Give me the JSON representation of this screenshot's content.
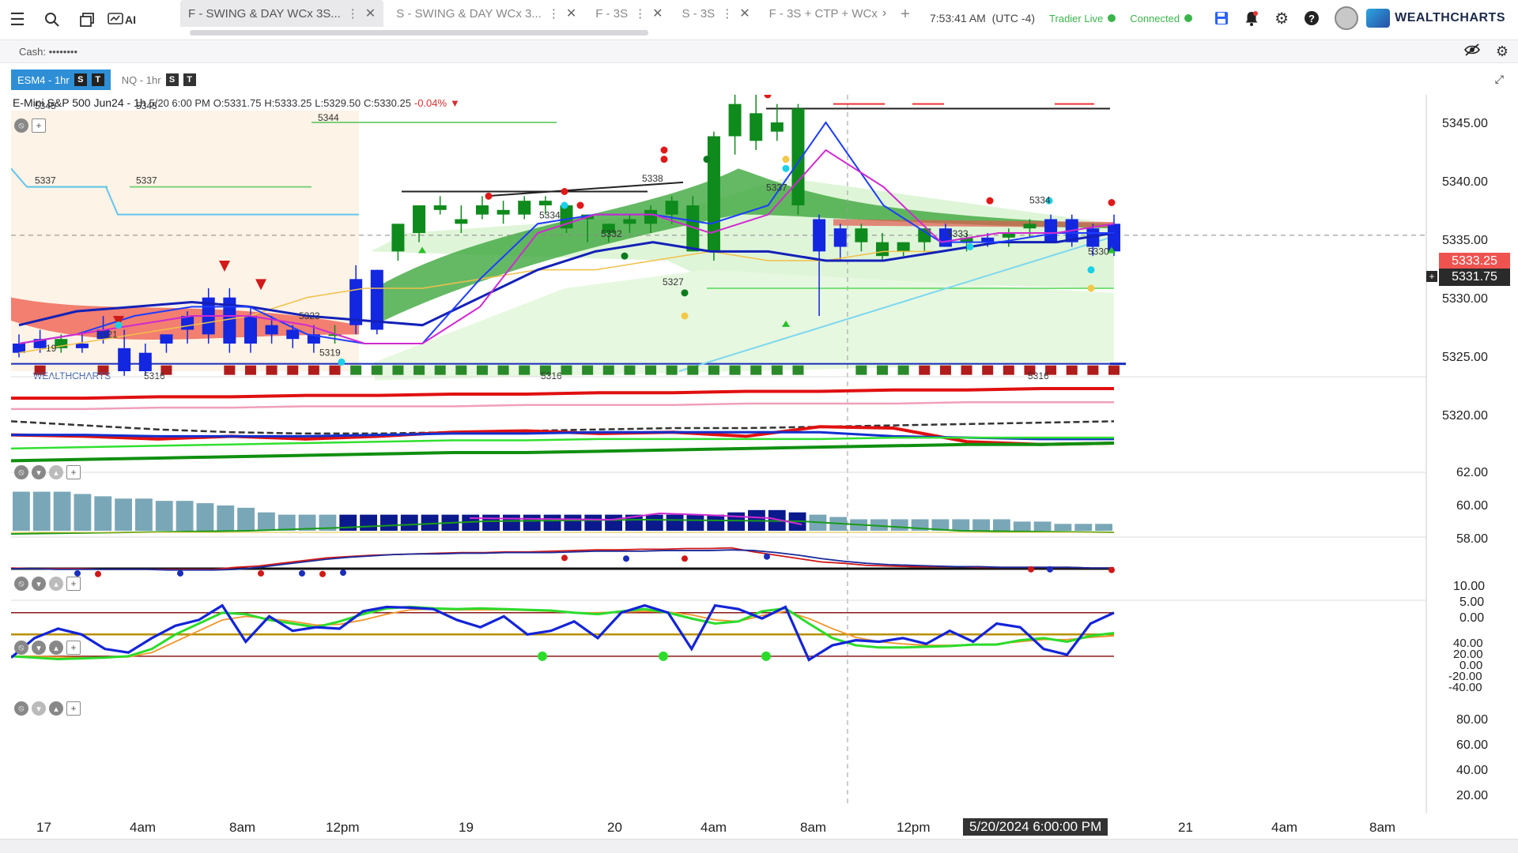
{
  "toolbar": {
    "ai_label": "AI"
  },
  "tabs": [
    {
      "label": "F - SWING & DAY WCx 3S...",
      "active": true
    },
    {
      "label": "S - SWING & DAY WCx 3..."
    },
    {
      "label": "F - 3S"
    },
    {
      "label": "S - 3S"
    },
    {
      "label": "F - 3S + CTP + WCx"
    }
  ],
  "header": {
    "clock": "7:53:41 AM",
    "tz": "(UTC -4)",
    "tradier": "Tradier Live",
    "connected": "Connected",
    "brand": "WEALTHCHARTS"
  },
  "cash": {
    "label": "Cash:",
    "value": "••••••••"
  },
  "chart_tabs": [
    {
      "label": "ESM4 - 1hr",
      "b1": "S",
      "b2": "T",
      "active": true
    },
    {
      "label": "NQ - 1hr",
      "b1": "S",
      "b2": "T"
    }
  ],
  "instrument": {
    "name": "E-Mini S&P 500 Jun24 - 1h",
    "date": "5/20 6:00 PM",
    "o": "O:5331.75",
    "h": "H:5333.25",
    "l": "L:5329.50",
    "c": "C:5330.25",
    "chg": "-0.04%"
  },
  "price_axis": [
    "5345.00",
    "5340.00",
    "5335.00",
    "5330.00",
    "5325.00",
    "5320.00"
  ],
  "price_tags": {
    "red": "5333.25",
    "dark": "5331.75"
  },
  "pane_axes": {
    "p1": [
      "62.00",
      "60.00",
      "58.00"
    ],
    "p2": [
      "10.00",
      "5.00",
      "0.00"
    ],
    "p3": [
      "40.00",
      "20.00",
      "0.00",
      "-20.00",
      "-40.00"
    ],
    "p4": [
      "80.00",
      "60.00",
      "40.00",
      "20.00"
    ]
  },
  "time_axis": [
    "17",
    "4am",
    "8am",
    "12pm",
    "19",
    "20",
    "4am",
    "8am",
    "12pm",
    "21",
    "4am",
    "8am"
  ],
  "time_cursor": "5/20/2024 6:00:00 PM",
  "chart_labels": {
    "l5345a": "5345",
    "l5345b": "5345",
    "l5344": "5344",
    "l5337a": "5337",
    "l5337b": "5337",
    "l5338": "5338",
    "l5337c": "5337",
    "l5334a": "5334",
    "l5334b": "5334",
    "l5332": "5332",
    "l5327": "5327",
    "l5323": "5323",
    "l5321": "5321",
    "l5319": "5319",
    "l19": "19",
    "l5316a": "5316",
    "l5316b": "5316",
    "l5316c": "5316",
    "l5333": "5333",
    "l5330": "5330",
    "watermark": "WEALTHCHARTS"
  },
  "chart_data": {
    "type": "candlestick",
    "title": "E-Mini S&P 500 Jun24 - 1h",
    "ylim": [
      5317,
      5347
    ],
    "candles": [
      {
        "o": 5320,
        "h": 5321,
        "l": 5318.5,
        "c": 5319,
        "col": "blue"
      },
      {
        "o": 5320.5,
        "h": 5321.5,
        "l": 5319,
        "c": 5319.5,
        "col": "blue"
      },
      {
        "o": 5319.5,
        "h": 5321,
        "l": 5319,
        "c": 5320.5,
        "col": "green"
      },
      {
        "o": 5320,
        "h": 5321,
        "l": 5319,
        "c": 5319.5,
        "col": "blue"
      },
      {
        "o": 5320.5,
        "h": 5323,
        "l": 5320,
        "c": 5321.5,
        "col": "blue"
      },
      {
        "o": 5319.5,
        "h": 5321.5,
        "l": 5316.5,
        "c": 5317,
        "col": "blue"
      },
      {
        "o": 5319,
        "h": 5320,
        "l": 5316.5,
        "c": 5317,
        "col": "blue"
      },
      {
        "o": 5320,
        "h": 5321,
        "l": 5319,
        "c": 5321,
        "col": "blue"
      },
      {
        "o": 5321.5,
        "h": 5323.5,
        "l": 5320,
        "c": 5323,
        "col": "blue"
      },
      {
        "o": 5325,
        "h": 5326,
        "l": 5320,
        "c": 5321,
        "col": "blue"
      },
      {
        "o": 5325,
        "h": 5326,
        "l": 5319,
        "c": 5320,
        "col": "blue"
      },
      {
        "o": 5323,
        "h": 5324,
        "l": 5319,
        "c": 5320,
        "col": "blue"
      },
      {
        "o": 5322,
        "h": 5323,
        "l": 5320,
        "c": 5321,
        "col": "blue"
      },
      {
        "o": 5321.5,
        "h": 5322,
        "l": 5319.5,
        "c": 5320.5,
        "col": "blue"
      },
      {
        "o": 5321,
        "h": 5322,
        "l": 5319,
        "c": 5320,
        "col": "blue"
      },
      {
        "o": 5321,
        "h": 5322,
        "l": 5320,
        "c": 5321,
        "col": "green"
      },
      {
        "o": 5327,
        "h": 5328.5,
        "l": 5321,
        "c": 5322,
        "col": "blue"
      },
      {
        "o": 5328,
        "h": 5328,
        "l": 5321,
        "c": 5321.5,
        "col": "blue"
      },
      {
        "o": 5330,
        "h": 5333,
        "l": 5329,
        "c": 5333,
        "col": "green"
      },
      {
        "o": 5332,
        "h": 5335,
        "l": 5331,
        "c": 5335,
        "col": "green"
      },
      {
        "o": 5335,
        "h": 5336,
        "l": 5334,
        "c": 5334.5,
        "col": "green"
      },
      {
        "o": 5333,
        "h": 5335,
        "l": 5332,
        "c": 5333.5,
        "col": "green"
      },
      {
        "o": 5334,
        "h": 5336,
        "l": 5333.5,
        "c": 5335,
        "col": "green"
      },
      {
        "o": 5334,
        "h": 5335.5,
        "l": 5333,
        "c": 5334.5,
        "col": "green"
      },
      {
        "o": 5334,
        "h": 5336,
        "l": 5333.5,
        "c": 5335.5,
        "col": "green"
      },
      {
        "o": 5335,
        "h": 5336,
        "l": 5334,
        "c": 5335.5,
        "col": "green"
      },
      {
        "o": 5335,
        "h": 5335,
        "l": 5332,
        "c": 5332.5,
        "col": "green"
      },
      {
        "o": 5334,
        "h": 5334,
        "l": 5331,
        "c": 5333.5,
        "col": "green"
      },
      {
        "o": 5333,
        "h": 5333,
        "l": 5331,
        "c": 5332,
        "col": "green"
      },
      {
        "o": 5333,
        "h": 5334,
        "l": 5332,
        "c": 5333.5,
        "col": "green"
      },
      {
        "o": 5333,
        "h": 5335,
        "l": 5332,
        "c": 5334.5,
        "col": "green"
      },
      {
        "o": 5334,
        "h": 5336,
        "l": 5333,
        "c": 5335.5,
        "col": "green"
      },
      {
        "o": 5335,
        "h": 5336,
        "l": 5330,
        "c": 5330,
        "col": "green"
      },
      {
        "o": 5330,
        "h": 5343,
        "l": 5329,
        "c": 5342.5,
        "col": "green"
      },
      {
        "o": 5342.5,
        "h": 5347,
        "l": 5340.5,
        "c": 5346,
        "col": "green"
      },
      {
        "o": 5345,
        "h": 5347.5,
        "l": 5341,
        "c": 5342,
        "col": "green"
      },
      {
        "o": 5343,
        "h": 5346,
        "l": 5342,
        "c": 5344,
        "col": "green"
      },
      {
        "o": 5345.5,
        "h": 5346,
        "l": 5334,
        "c": 5335,
        "col": "green"
      },
      {
        "o": 5333.5,
        "h": 5334,
        "l": 5323,
        "c": 5330,
        "col": "blue"
      },
      {
        "o": 5332.5,
        "h": 5333,
        "l": 5329,
        "c": 5330.5,
        "col": "blue"
      },
      {
        "o": 5332.5,
        "h": 5333,
        "l": 5330,
        "c": 5331,
        "col": "green"
      },
      {
        "o": 5331,
        "h": 5332,
        "l": 5329,
        "c": 5329.5,
        "col": "green"
      },
      {
        "o": 5330,
        "h": 5331,
        "l": 5329.5,
        "c": 5331,
        "col": "green"
      },
      {
        "o": 5331,
        "h": 5332.5,
        "l": 5330,
        "c": 5332.5,
        "col": "green"
      },
      {
        "o": 5332.5,
        "h": 5333,
        "l": 5330.5,
        "c": 5330.5,
        "col": "blue"
      },
      {
        "o": 5331,
        "h": 5332,
        "l": 5330,
        "c": 5331.5,
        "col": "green"
      },
      {
        "o": 5331,
        "h": 5332,
        "l": 5330.5,
        "c": 5331.5,
        "col": "blue"
      },
      {
        "o": 5331.5,
        "h": 5332.5,
        "l": 5330.5,
        "c": 5332,
        "col": "green"
      },
      {
        "o": 5332.5,
        "h": 5333.5,
        "l": 5331.5,
        "c": 5333,
        "col": "green"
      },
      {
        "o": 5333.5,
        "h": 5334,
        "l": 5331,
        "c": 5331,
        "col": "blue"
      },
      {
        "o": 5333.5,
        "h": 5334,
        "l": 5330.5,
        "c": 5331,
        "col": "blue"
      },
      {
        "o": 5332.5,
        "h": 5333,
        "l": 5329.5,
        "c": 5330.5,
        "col": "blue"
      },
      {
        "o": 5333,
        "h": 5334,
        "l": 5329.5,
        "c": 5330,
        "col": "blue"
      }
    ],
    "pane1": {
      "ylim": [
        56.5,
        63
      ],
      "series": [
        {
          "color": "#e01010",
          "values": [
            61.6,
            61.6,
            61.7,
            61.7,
            61.8,
            61.8,
            61.9,
            61.9,
            62.0,
            62.0,
            62.1,
            62.1,
            62.2,
            62.2,
            62.3,
            62.3
          ]
        },
        {
          "color": "#f0a0b8",
          "values": [
            60.8,
            60.8,
            60.9,
            60.9,
            61.0,
            61.0,
            61.0,
            61.1,
            61.1,
            61.1,
            61.2,
            61.2,
            61.2,
            61.3,
            61.3,
            61.3
          ]
        },
        {
          "color": "#333333",
          "values": [
            59.9,
            59.6,
            59.3,
            59.1,
            59.0,
            59.0,
            59.1,
            59.2,
            59.3,
            59.4,
            59.4,
            59.5,
            59.6,
            59.7,
            59.8,
            59.9
          ]
        },
        {
          "color": "#e01010",
          "values": [
            58.9,
            58.8,
            58.6,
            58.8,
            58.6,
            58.8,
            59.1,
            59.2,
            59.0,
            59.1,
            58.8,
            59.5,
            59.4,
            58.4,
            58.2,
            58.3
          ]
        },
        {
          "color": "#1030d0",
          "values": [
            58.9,
            58.9,
            58.8,
            58.8,
            58.8,
            58.9,
            59.0,
            59.0,
            59.1,
            59.1,
            59.1,
            59.1,
            58.8,
            58.7,
            58.6,
            58.6
          ]
        },
        {
          "color": "#30e030",
          "values": [
            57.9,
            58.0,
            58.1,
            58.2,
            58.3,
            58.4,
            58.5,
            58.5,
            58.6,
            58.6,
            58.6,
            58.6,
            58.7,
            58.7,
            58.7,
            58.7
          ]
        },
        {
          "color": "#109010",
          "values": [
            57.0,
            57.1,
            57.2,
            57.3,
            57.4,
            57.5,
            57.6,
            57.6,
            57.7,
            57.8,
            57.9,
            58.0,
            58.1,
            58.2,
            58.2,
            58.3
          ]
        }
      ]
    },
    "pane2": {
      "ylim": [
        0,
        11
      ],
      "bars": [
        8.5,
        8.5,
        8.5,
        8,
        7.5,
        7,
        7,
        6.5,
        6.5,
        6,
        5.5,
        5,
        4,
        3.5,
        3.5,
        3.5,
        3.5,
        3.5,
        3.5,
        3.5,
        3.5,
        3.5,
        3.5,
        3.5,
        3.5,
        3.5,
        3.5,
        3.5,
        3.5,
        3.5,
        3.5,
        3.5,
        3.5,
        3.5,
        3.5,
        4,
        4.5,
        4.5,
        4,
        3.5,
        3,
        2.5,
        2.5,
        2.5,
        2.5,
        2.5,
        2.5,
        2.5,
        2.5,
        2,
        2,
        1.5,
        1.5,
        1.5
      ],
      "dark": [
        16,
        17,
        18,
        19,
        20,
        21,
        22,
        23,
        24,
        25,
        26,
        27,
        28,
        29,
        30,
        31,
        32,
        33,
        34,
        35,
        36,
        37,
        38
      ]
    },
    "pane3": {
      "ylim": [
        -40,
        40
      ],
      "lineA": [
        1,
        0,
        0,
        0,
        -1,
        -1,
        -1,
        -1,
        -1,
        -1,
        2,
        4,
        8,
        12,
        16,
        18,
        20,
        21,
        22,
        23,
        24,
        24,
        25,
        25,
        26,
        27,
        28,
        28,
        29,
        29,
        30,
        30,
        31,
        25,
        20,
        15,
        10,
        8,
        5,
        4,
        3,
        3,
        3,
        2,
        2,
        2,
        2,
        2,
        1,
        1
      ],
      "lineB": [
        0,
        0,
        -1,
        -1,
        -1,
        -1,
        -1,
        -2,
        -2,
        -2,
        -1,
        2,
        6,
        10,
        14,
        17,
        19,
        21,
        22,
        22,
        23,
        23,
        24,
        24,
        24,
        25,
        26,
        26,
        26,
        27,
        27,
        27,
        28,
        27,
        24,
        20,
        15,
        11,
        8,
        6,
        5,
        4,
        3,
        3,
        2,
        2,
        2,
        2,
        1,
        1
      ]
    },
    "pane4": {
      "ylim": [
        10,
        95
      ],
      "blue": [
        18,
        45,
        58,
        50,
        30,
        25,
        45,
        62,
        70,
        90,
        40,
        75,
        55,
        60,
        58,
        82,
        88,
        87,
        85,
        70,
        60,
        75,
        50,
        55,
        68,
        45,
        80,
        90,
        80,
        30,
        90,
        85,
        72,
        88,
        15,
        35,
        42,
        40,
        45,
        37,
        55,
        40,
        65,
        60,
        30,
        22,
        65,
        80
      ],
      "green": [
        20,
        18,
        16,
        17,
        18,
        20,
        30,
        50,
        65,
        80,
        78,
        70,
        65,
        60,
        68,
        78,
        86,
        88,
        86,
        85,
        86,
        85,
        84,
        83,
        80,
        78,
        82,
        85,
        80,
        72,
        65,
        68,
        82,
        86,
        65,
        45,
        35,
        32,
        32,
        33,
        34,
        36,
        36,
        42,
        45,
        40,
        48,
        52
      ],
      "orange": [
        20,
        20,
        19,
        18,
        18,
        19,
        25,
        40,
        55,
        70,
        75,
        72,
        68,
        63,
        64,
        70,
        78,
        84,
        85,
        84,
        84,
        84,
        83,
        82,
        80,
        80,
        81,
        82,
        81,
        77,
        70,
        68,
        76,
        82,
        72,
        58,
        46,
        40,
        37,
        35,
        35,
        36,
        37,
        40,
        43,
        43,
        46,
        48
      ]
    }
  }
}
